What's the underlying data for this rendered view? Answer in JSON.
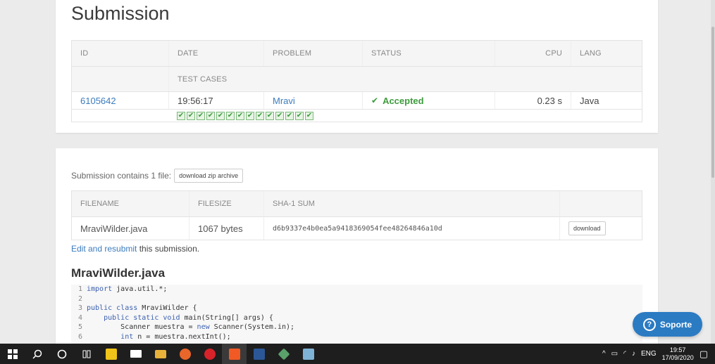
{
  "page": {
    "title": "Submission"
  },
  "submission": {
    "headers": {
      "id": "ID",
      "date": "DATE",
      "problem": "PROBLEM",
      "status": "STATUS",
      "cpu": "CPU",
      "lang": "LANG",
      "test_cases": "TEST CASES"
    },
    "row": {
      "id": "6105642",
      "date": "19:56:17",
      "problem": "Mravi",
      "status": "Accepted",
      "cpu": "0.23 s",
      "lang": "Java"
    },
    "test_case_count": 14,
    "status_color": "#3e9b3e"
  },
  "files": {
    "contains_text": "Submission contains 1 file:",
    "download_zip_label": "download zip archive",
    "headers": {
      "filename": "FILENAME",
      "filesize": "FILESIZE",
      "sha": "SHA-1 SUM"
    },
    "rows": [
      {
        "filename": "MraviWilder.java",
        "filesize": "1067 bytes",
        "sha": "d6b9337e4b0ea5a9418369054fee48264846a10d",
        "download_label": "download"
      }
    ],
    "resubmit_link": "Edit and resubmit",
    "resubmit_suffix": " this submission."
  },
  "code": {
    "filename": "MraviWilder.java",
    "lines": [
      {
        "n": "1",
        "text": "import java.util.*;"
      },
      {
        "n": "2",
        "text": ""
      },
      {
        "n": "3",
        "text": "public class MraviWilder {"
      },
      {
        "n": "4",
        "text": "    public static void main(String[] args) {"
      },
      {
        "n": "5",
        "text": "        Scanner muestra = new Scanner(System.in);"
      },
      {
        "n": "6",
        "text": "        int n = muestra.nextInt();"
      }
    ]
  },
  "support": {
    "label": "Soporte",
    "color": "#2b7bc3"
  },
  "taskbar": {
    "lang": "ENG",
    "time": "19:57",
    "date": "17/09/2020"
  }
}
